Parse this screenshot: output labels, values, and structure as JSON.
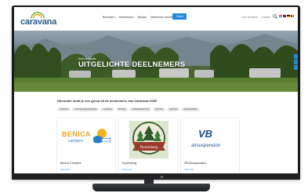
{
  "header": {
    "logo_text": "caravana",
    "nav": [
      "Bezoeken",
      "Deelnemers",
      "Nieuws",
      "Deelnemer worden"
    ],
    "cta": "Ticket",
    "utility": [
      "Over de Beurs",
      "Contact"
    ],
    "flags": [
      "NL",
      "EN",
      "DE",
      "BE"
    ]
  },
  "hero": {
    "eyebrow": "Voor uw plezier",
    "title": "UITGELICHTE DEELNEMERS"
  },
  "intro": {
    "text": "Hieronder vindt je een greep uit de deelnemers van Caravana 2025!"
  },
  "filters": [
    "CARAVAN",
    "CARAVAN RESTAURATIE",
    "CAMPING",
    "TENTEN",
    "CAMPERVERHUUR",
    "BOOTEN",
    "FIETSEN",
    "ACCESSOIRES"
  ],
  "cards": [
    {
      "name": "Benica Campers",
      "link": "Lees meer",
      "logo_main": "BENICA",
      "logo_sub": "campers"
    },
    {
      "name": "Dorrenberg",
      "link": "Lees meer",
      "logo_main": "Dorrenberg"
    },
    {
      "name": "VB Airsuspension",
      "link": "Lees meer",
      "logo_main": "VB",
      "logo_sub": "airsuspension"
    }
  ],
  "colors": {
    "accent": "#1f88d9",
    "logo_blue": "#2a5b8f",
    "benica_orange": "#f0a320",
    "vb_blue": "#1b4a8c"
  }
}
